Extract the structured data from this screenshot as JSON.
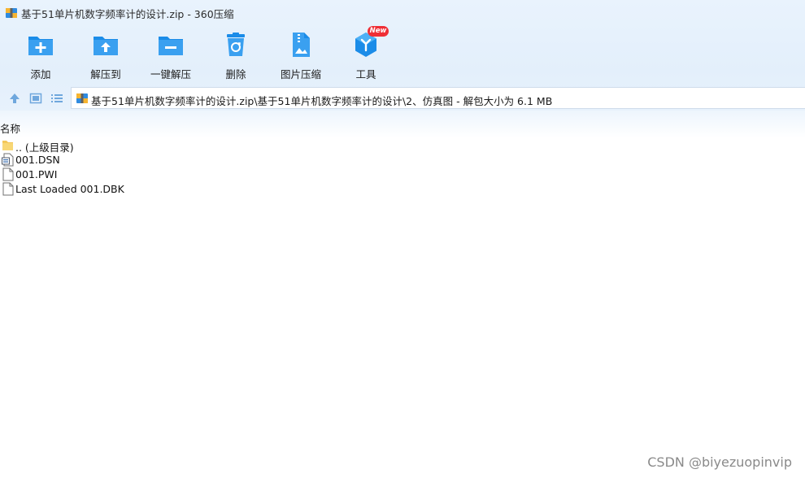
{
  "window": {
    "title": "基于51单片机数字频率计的设计.zip - 360压缩"
  },
  "toolbar": {
    "add_label": "添加",
    "extract_to_label": "解压到",
    "one_click_extract_label": "一键解压",
    "delete_label": "删除",
    "image_compress_label": "图片压缩",
    "tools_label": "工具",
    "new_badge": "New"
  },
  "address_bar": {
    "path": "基于51单片机数字频率计的设计.zip\\基于51单片机数字频率计的设计\\2、仿真图 - 解包大小为 6.1 MB"
  },
  "file_list": {
    "column_name": "名称",
    "items": [
      {
        "label": ".. (上级目录)",
        "icon": "folder-icon"
      },
      {
        "label": "001.DSN",
        "icon": "dsn-file-icon"
      },
      {
        "label": "001.PWI",
        "icon": "file-icon"
      },
      {
        "label": "Last Loaded 001.DBK",
        "icon": "file-icon"
      }
    ]
  },
  "watermark": "CSDN @biyezuopinvip",
  "colors": {
    "accent_blue": "#1b8ce8",
    "badge_red": "#ef2e35",
    "header_bg": "#e6f1fc"
  }
}
